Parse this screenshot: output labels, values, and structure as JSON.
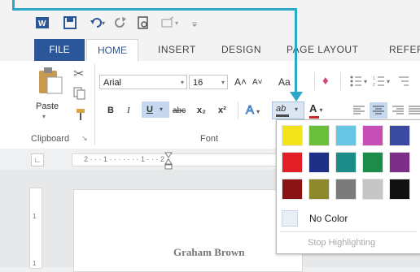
{
  "ribbon_tabs": {
    "file": "FILE",
    "home": "HOME",
    "insert": "INSERT",
    "design": "DESIGN",
    "page_layout": "PAGE LAYOUT",
    "references": "REFERE"
  },
  "clipboard": {
    "paste_label": "Paste",
    "group_label": "Clipboard"
  },
  "font": {
    "family": "Arial",
    "size": "16",
    "group_label": "Font",
    "bold": "B",
    "italic": "I",
    "underline": "U",
    "strikethrough": "abc",
    "subscript": "x₂",
    "superscript": "x²",
    "grow": "A˄",
    "shrink": "A˅",
    "case": "Aa",
    "text_effects": "A",
    "highlight": "ab",
    "font_color": "A"
  },
  "ruler": {
    "marks": "2 · · · 1 · · · · · · · 1 · · · 2 ·"
  },
  "document": {
    "author_name": "Graham Brown"
  },
  "highlight_menu": {
    "colors": [
      "#f2e31a",
      "#6bbf3a",
      "#66c6e3",
      "#c54fb5",
      "#3a4aa1",
      "#e21f26",
      "#1e2f85",
      "#1b8c88",
      "#1d8b4a",
      "#7c2d86",
      "#8a1414",
      "#8c8a2b",
      "#7b7b7b",
      "#c6c6c6",
      "#111111"
    ],
    "no_color_label": "No Color",
    "stop_label": "Stop Highlighting"
  },
  "accent_colors": {
    "callout": "#2aa7c9",
    "file_tab": "#2b579a"
  }
}
